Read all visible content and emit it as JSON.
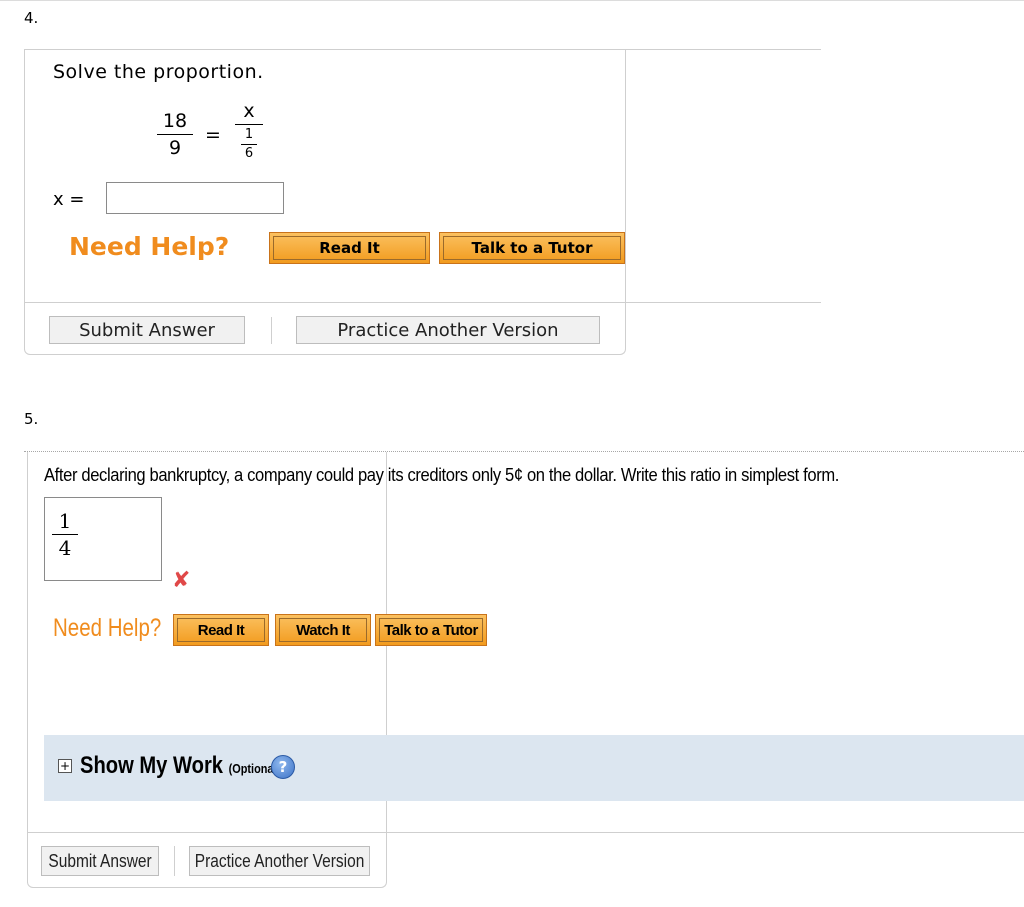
{
  "q4": {
    "number": "4.",
    "prompt": "Solve the proportion.",
    "proportion": {
      "left": {
        "num": "18",
        "den": "9"
      },
      "equals": "=",
      "right": {
        "num": "x",
        "den_num": "1",
        "den_den": "6"
      }
    },
    "answer_label": "x =",
    "answer_value": "",
    "need_help": "Need Help?",
    "buttons": {
      "read_it": "Read It",
      "talk_tutor": "Talk to a Tutor"
    },
    "submit": "Submit Answer",
    "practice": "Practice Another Version"
  },
  "q5": {
    "number": "5.",
    "prompt": "After declaring bankruptcy, a company could pay its creditors only 5¢ on the dollar. Write this ratio in simplest form.",
    "answer": {
      "num": "1",
      "den": "4"
    },
    "result_icon": "✘",
    "need_help": "Need Help?",
    "buttons": {
      "read_it": "Read It",
      "watch_it": "Watch It",
      "talk_tutor": "Talk to a Tutor"
    },
    "show_my_work": {
      "toggle": "+",
      "title": "Show My Work",
      "optional": "(Optional)",
      "help_glyph": "?"
    },
    "submit": "Submit Answer",
    "practice": "Practice Another Version"
  },
  "colors": {
    "help_orange": "#f08c1e",
    "button_orange": "#f29b1e",
    "panel_blue": "#dce6f0",
    "error_red": "#e04848"
  }
}
